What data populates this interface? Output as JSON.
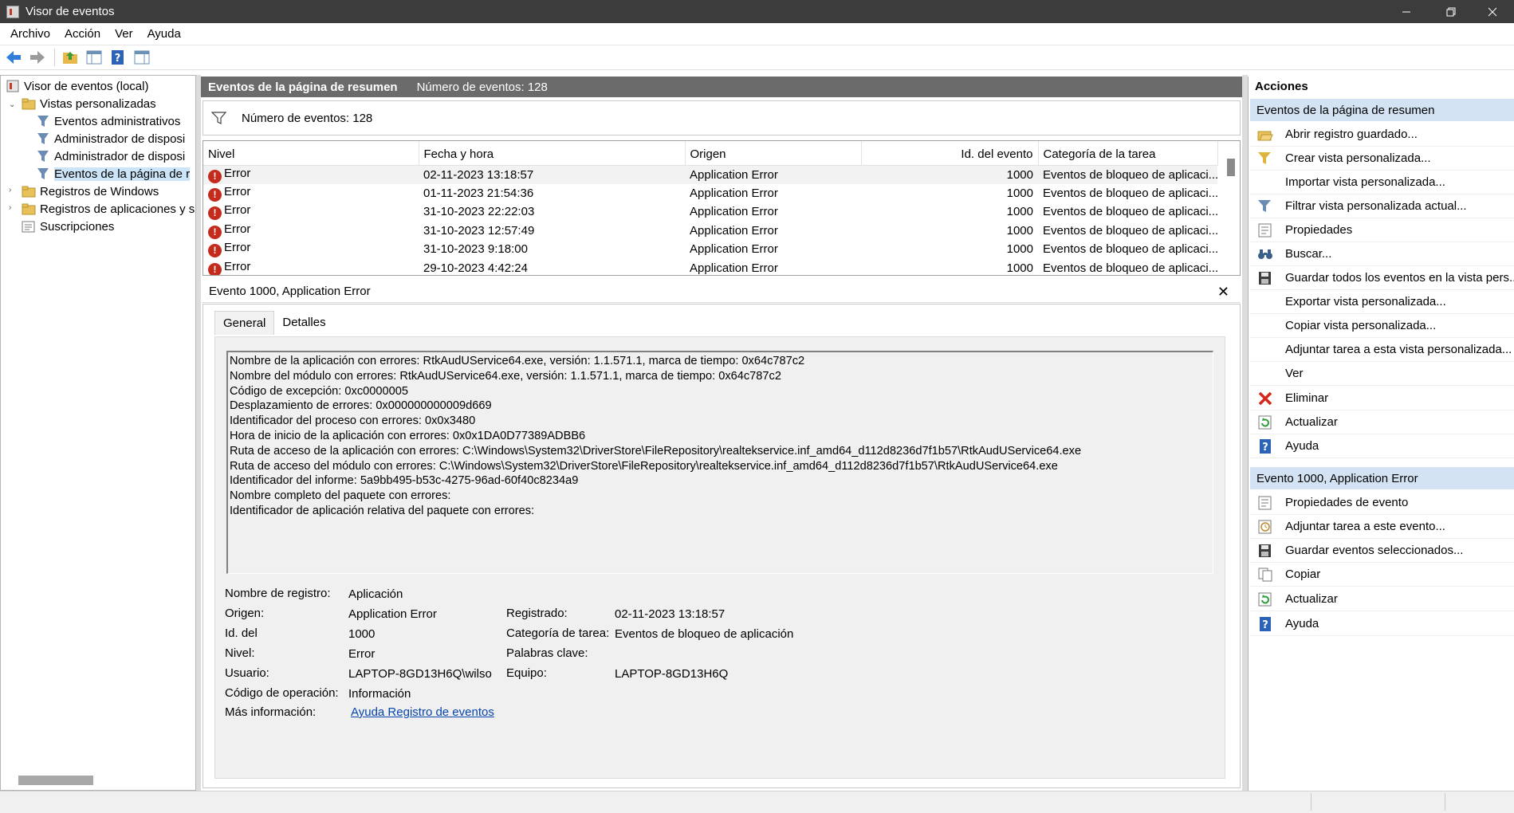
{
  "window": {
    "title": "Visor de eventos"
  },
  "menu": [
    "Archivo",
    "Acción",
    "Ver",
    "Ayuda"
  ],
  "toolbar": [
    "back-arrow-icon",
    "forward-arrow-icon",
    "folder-up-icon",
    "show-hide-tree-icon",
    "help-icon",
    "show-hide-actions-icon"
  ],
  "tree": {
    "root": "Visor de eventos (local)",
    "custom_views": "Vistas personalizadas",
    "admin_events": "Eventos administrativos",
    "device_admin_1": "Administrador de disposi",
    "device_admin_2": "Administrador de disposi",
    "summary_events": "Eventos de la página de r",
    "windows_logs": "Registros de Windows",
    "app_logs": "Registros de aplicaciones y se",
    "subscriptions": "Suscripciones"
  },
  "middle": {
    "header_title": "Eventos de la página de resumen",
    "header_count": "Número de eventos: 128",
    "filter_text": "Número de eventos: 128",
    "columns": {
      "level": "Nivel",
      "datetime": "Fecha y hora",
      "source": "Origen",
      "event_id": "Id. del evento",
      "category": "Categoría de la tarea"
    },
    "rows": [
      {
        "level": "Error",
        "datetime": "02-11-2023 13:18:57",
        "source": "Application Error",
        "event_id": "1000",
        "category": "Eventos de bloqueo de aplicaci..."
      },
      {
        "level": "Error",
        "datetime": "01-11-2023 21:54:36",
        "source": "Application Error",
        "event_id": "1000",
        "category": "Eventos de bloqueo de aplicaci..."
      },
      {
        "level": "Error",
        "datetime": "31-10-2023 22:22:03",
        "source": "Application Error",
        "event_id": "1000",
        "category": "Eventos de bloqueo de aplicaci..."
      },
      {
        "level": "Error",
        "datetime": "31-10-2023 12:57:49",
        "source": "Application Error",
        "event_id": "1000",
        "category": "Eventos de bloqueo de aplicaci..."
      },
      {
        "level": "Error",
        "datetime": "31-10-2023 9:18:00",
        "source": "Application Error",
        "event_id": "1000",
        "category": "Eventos de bloqueo de aplicaci..."
      },
      {
        "level": "Error",
        "datetime": "29-10-2023 4:42:24",
        "source": "Application Error",
        "event_id": "1000",
        "category": "Eventos de bloqueo de aplicaci..."
      }
    ]
  },
  "detail": {
    "title": "Evento 1000, Application Error",
    "close": "✕",
    "tabs": {
      "general": "General",
      "details": "Detalles"
    },
    "description": [
      "Nombre de la aplicación con errores: RtkAudUService64.exe, versión: 1.1.571.1, marca de tiempo: 0x64c787c2",
      "Nombre del módulo con errores: RtkAudUService64.exe, versión: 1.1.571.1, marca de tiempo: 0x64c787c2",
      "Código de excepción: 0xc0000005",
      "Desplazamiento de errores: 0x000000000009d669",
      "Identificador del proceso con errores: 0x0x3480",
      "Hora de inicio de la aplicación con errores: 0x0x1DA0D77389ADBB6",
      "Ruta de acceso de la aplicación con errores: C:\\Windows\\System32\\DriverStore\\FileRepository\\realtekservice.inf_amd64_d112d8236d7f1b57\\RtkAudUService64.exe",
      "Ruta de acceso del módulo con errores: C:\\Windows\\System32\\DriverStore\\FileRepository\\realtekservice.inf_amd64_d112d8236d7f1b57\\RtkAudUService64.exe",
      "Identificador del informe: 5a9bb495-b53c-4275-96ad-60f40c8234a9",
      "Nombre completo del paquete con errores:",
      "Identificador de aplicación relativa del paquete con errores:"
    ],
    "props": {
      "log_name_label": "Nombre de registro:",
      "log_name": "Aplicación",
      "source_label": "Origen:",
      "source": "Application Error",
      "logged_label": "Registrado:",
      "logged": "02-11-2023 13:18:57",
      "event_id_label": "Id. del",
      "event_id": "1000",
      "task_category_label": "Categoría de tarea:",
      "task_category": "Eventos de bloqueo de aplicación",
      "level_label": "Nivel:",
      "level": "Error",
      "keywords_label": "Palabras clave:",
      "user_label": "Usuario:",
      "user": "LAPTOP-8GD13H6Q\\wilso",
      "computer_label": "Equipo:",
      "computer": "LAPTOP-8GD13H6Q",
      "opcode_label": "Código de operación:",
      "opcode": "Información",
      "more_info_label": "Más información:",
      "more_info_link": "Ayuda Registro de eventos"
    }
  },
  "actions": {
    "title": "Acciones",
    "section1": "Eventos de la página de resumen",
    "section1_items": [
      "Abrir registro guardado...",
      "Crear vista personalizada...",
      "Importar vista personalizada...",
      "Filtrar vista personalizada actual...",
      "Propiedades",
      "Buscar...",
      "Guardar todos los eventos en la vista pers...",
      "Exportar vista personalizada...",
      "Copiar vista personalizada...",
      "Adjuntar tarea a esta vista personalizada...",
      "Ver",
      "Eliminar",
      "Actualizar",
      "Ayuda"
    ],
    "section2": "Evento 1000, Application Error",
    "section2_items": [
      "Propiedades de evento",
      "Adjuntar tarea a este evento...",
      "Guardar eventos seleccionados...",
      "Copiar",
      "Actualizar",
      "Ayuda"
    ]
  },
  "colors": {
    "error": "#c42b1c",
    "section_bg": "#d4e3f3",
    "header_bg": "#6b6b6b",
    "selection": "#cce4f7"
  }
}
